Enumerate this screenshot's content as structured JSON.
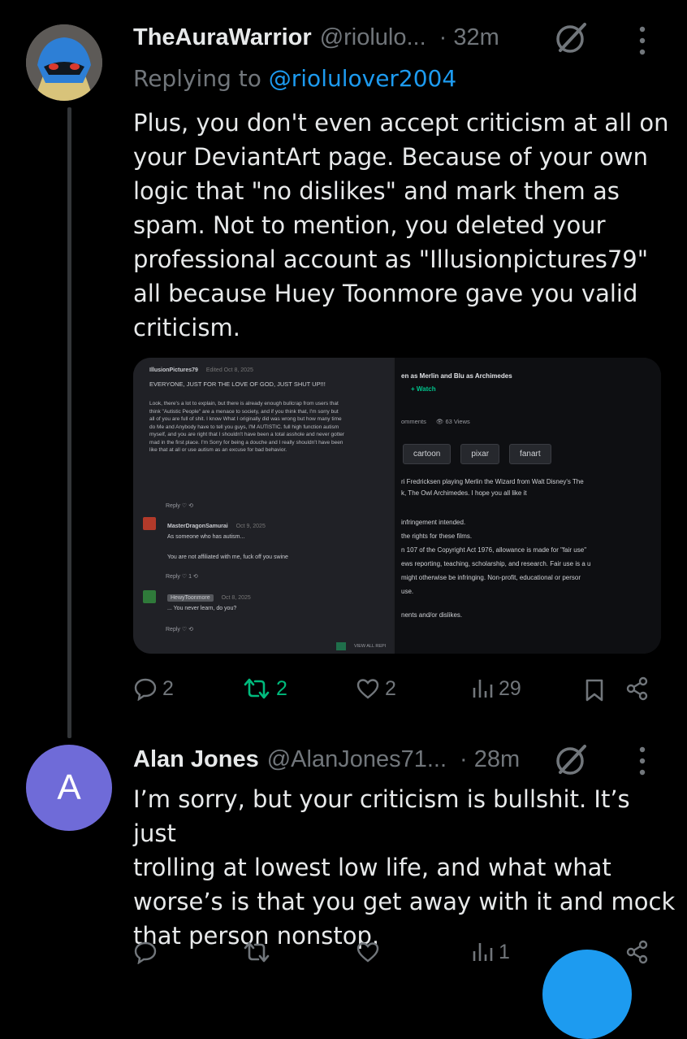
{
  "tweet1": {
    "name": "TheAuraWarrior",
    "handle": "@riolulo...",
    "time": "· 32m",
    "replying_prefix": "Replying to ",
    "replying_to": "@riolulover2004",
    "text_lines": [
      "Plus, you don't even accept criticism at all on",
      "your DeviantArt page. Because of your own",
      "logic that \"no dislikes\" and mark them as",
      "spam. Not to mention, you deleted your",
      "professional account as \"Illusionpictures79\"",
      "all because Huey Toonmore gave you valid",
      "criticism."
    ],
    "actions": {
      "replies": "2",
      "reposts": "2",
      "likes": "2",
      "views": "29"
    }
  },
  "media": {
    "left": {
      "author": "IllusionPictures79",
      "edited": "Edited Oct 8, 2025",
      "headline": "EVERYONE, JUST FOR THE LOVE OF GOD, JUST SHUT UP!!!",
      "body_lines": [
        "Look, there's a lot to explain, but there is already enough bullcrap from users that",
        "think \"Autistic People\" are a menace to society, and if you think that, I'm sorry but",
        "all of you are full of shit. I know What I originally did was wrong but how many time",
        "do Me and Anybody have to tell you guys, I'M AUTISTIC. full high function autism",
        "myself, and you are right that I shouldn't have been a total asshole and never gotter",
        "mad in the first place. I'm Sorry for being a douche and I really shouldn't have been",
        "like that at all or use autism as an excuse for bad behavior."
      ],
      "reply_label": "Reply",
      "comments": [
        {
          "user": "MasterDragonSamurai",
          "date": "Oct 9, 2025",
          "lines": [
            "As someone who has autism..."
          ]
        },
        {
          "user": "",
          "date": "",
          "lines": [
            "You are not affiliated with me, fuck off you swine"
          ],
          "likes": "1"
        },
        {
          "user": "HewyToonmore",
          "date": "Oct 8, 2025",
          "lines": [
            "... You never learn, do you?"
          ]
        }
      ],
      "view_all": "VIEW ALL REPI"
    },
    "right": {
      "title": "en as Merlin and Blu as Archimedes",
      "watch": "+ Watch",
      "comments_label": "omments",
      "views": "63 Views",
      "tags": [
        "cartoon",
        "pixar",
        "fanart"
      ],
      "desc_lines": [
        "ri Fredricksen playing Merlin the Wizard from Walt Disney's The",
        "k, The Owl Archimedes. I hope you all like it"
      ],
      "legal_lines": [
        "infringement intended.",
        "the rights for these films.",
        "n 107 of the Copyright Act 1976, allowance is made for \"fair use\"",
        "ews reporting, teaching, scholarship, and research. Fair use is a u",
        "might otherwise be infringing. Non-profit, educational or persor",
        "use."
      ],
      "footer": "nents and/or dislikes."
    }
  },
  "tweet2": {
    "avatar_letter": "A",
    "name": "Alan Jones",
    "handle": "@AlanJones71...",
    "time": "· 28m",
    "text_lines": [
      "I’m sorry, but your criticism is bullshit. It’s just",
      "trolling at lowest low life, and what what",
      "worse’s is that you get away with it and mock",
      "that person nonstop."
    ],
    "actions": {
      "views": "1"
    }
  },
  "colors": {
    "accent": "#1d9bf0",
    "repost_active": "#00ba7c",
    "muted": "#71767b",
    "avatar_alan": "#6f6bd8"
  }
}
